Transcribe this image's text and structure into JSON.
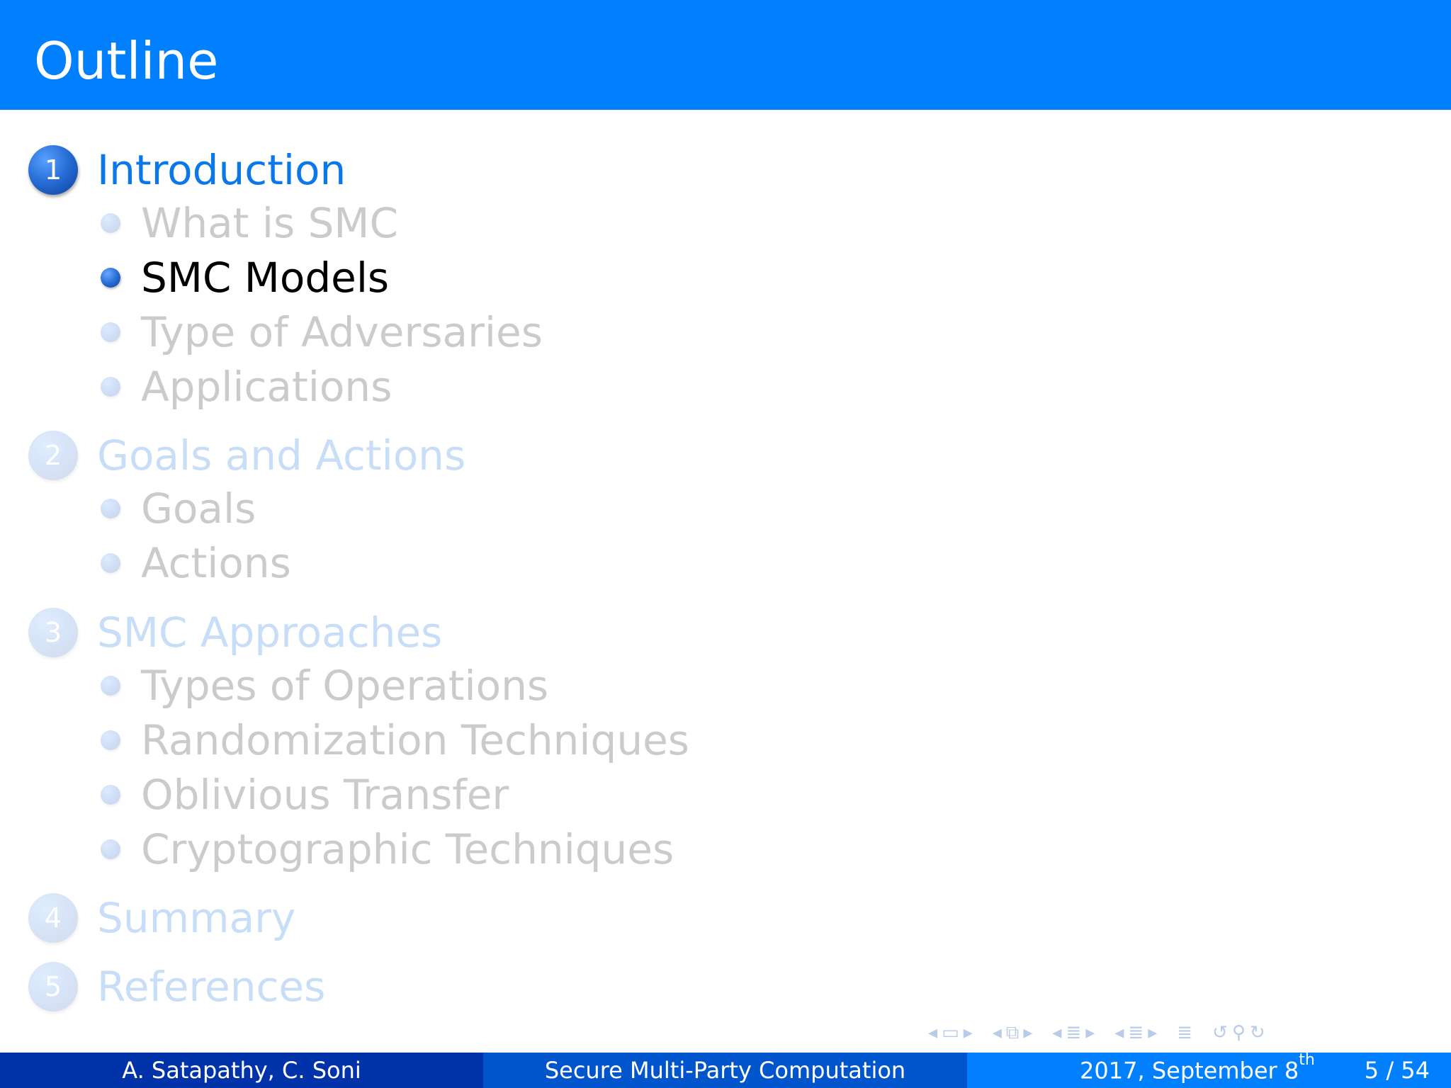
{
  "header": {
    "title": "Outline"
  },
  "toc": {
    "sections": [
      {
        "number": "1",
        "label": "Introduction",
        "state": "current",
        "subsections": [
          {
            "label": "What is SMC",
            "state": "faded"
          },
          {
            "label": "SMC Models",
            "state": "current"
          },
          {
            "label": "Type of Adversaries",
            "state": "faded"
          },
          {
            "label": "Applications",
            "state": "faded"
          }
        ]
      },
      {
        "number": "2",
        "label": "Goals and Actions",
        "state": "faded",
        "subsections": [
          {
            "label": "Goals",
            "state": "faded"
          },
          {
            "label": "Actions",
            "state": "faded"
          }
        ]
      },
      {
        "number": "3",
        "label": "SMC Approaches",
        "state": "faded",
        "subsections": [
          {
            "label": "Types of Operations",
            "state": "faded"
          },
          {
            "label": "Randomization Techniques",
            "state": "faded"
          },
          {
            "label": "Oblivious Transfer",
            "state": "faded"
          },
          {
            "label": "Cryptographic Techniques",
            "state": "faded"
          }
        ]
      },
      {
        "number": "4",
        "label": "Summary",
        "state": "faded",
        "subsections": []
      },
      {
        "number": "5",
        "label": "References",
        "state": "faded",
        "subsections": []
      }
    ]
  },
  "nav": {
    "icons": [
      "prev-arrow-icon",
      "frame-icon",
      "next-arrow-icon",
      "prev-arrow-icon",
      "subsection-icon",
      "next-arrow-icon",
      "prev-arrow-icon",
      "section-icon",
      "next-arrow-icon",
      "prev-arrow-icon",
      "subsection-list-icon",
      "next-arrow-icon",
      "toc-icon",
      "undo-icon",
      "search-icon",
      "redo-icon"
    ]
  },
  "footer": {
    "authors": "A. Satapathy, C. Soni",
    "title": "Secure Multi-Party Computation",
    "date_prefix": "2017, September 8",
    "date_suffix": "th",
    "page": "5 / 54"
  },
  "colors": {
    "header_bg": "#0080ff",
    "footer_left": "#0033aa",
    "footer_mid": "#0055cc",
    "footer_right": "#0080ff"
  }
}
